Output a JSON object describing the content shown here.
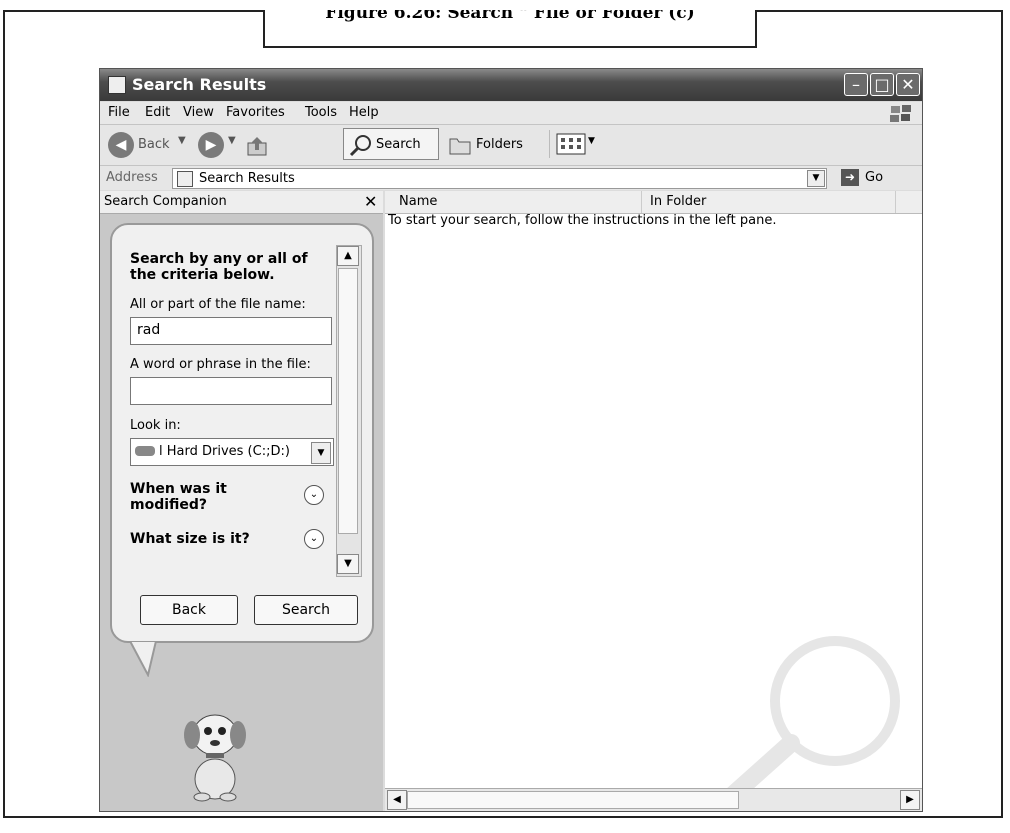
{
  "caption": "Figure 6.26: Search \" File or Folder (c)",
  "window": {
    "title": "Search Results",
    "menu": [
      "File",
      "Edit",
      "View",
      "Favorites",
      "Tools",
      "Help"
    ],
    "toolbar": {
      "back": "Back",
      "search": "Search",
      "folders": "Folders"
    },
    "address": {
      "label": "Address",
      "value": "Search Results",
      "go": "Go"
    }
  },
  "left_pane": {
    "title": "Search Companion",
    "heading": "Search by any or all of the criteria below.",
    "filename_label": "All or part of the file name:",
    "filename_value": "rad",
    "phrase_label": "A word or phrase in the file:",
    "phrase_value": "",
    "lookin_label": "Look in:",
    "lookin_value": "l Hard Drives (C:;D:)",
    "modified_label": "When was it modified?",
    "size_label": "What size is it?",
    "back_button": "Back",
    "search_button": "Search"
  },
  "right_pane": {
    "columns": [
      "Name",
      "In Folder"
    ],
    "message": "To start your search, follow the instructions in the left pane."
  }
}
